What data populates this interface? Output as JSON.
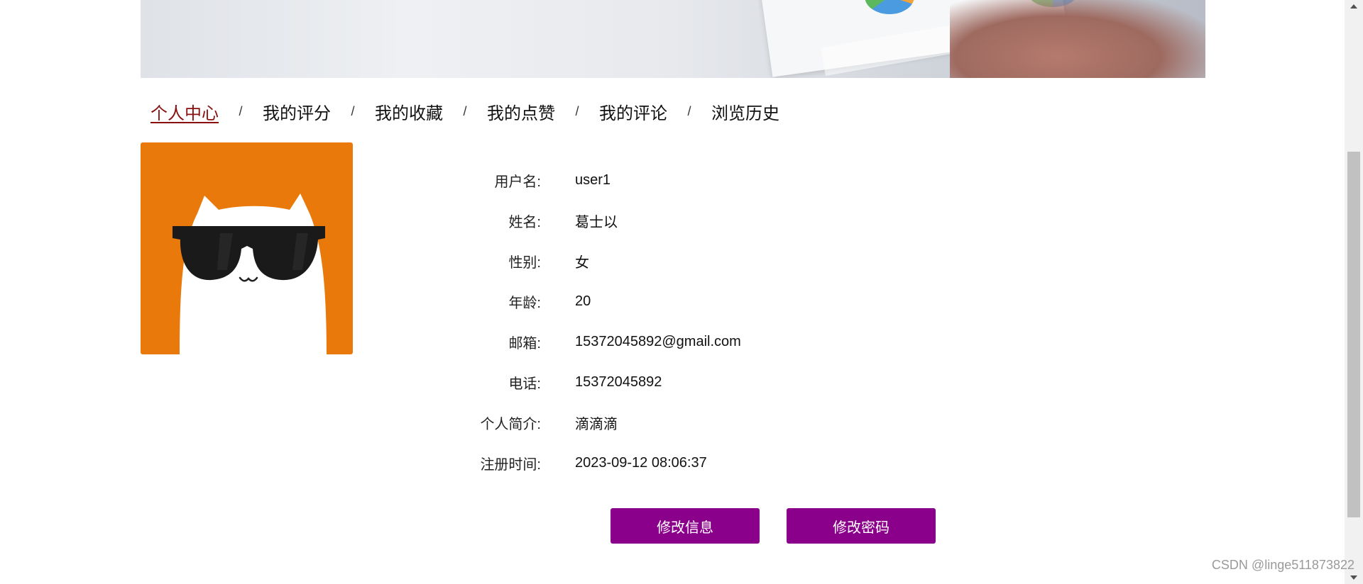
{
  "nav": {
    "items": [
      {
        "label": "个人中心",
        "active": true
      },
      {
        "label": "我的评分",
        "active": false
      },
      {
        "label": "我的收藏",
        "active": false
      },
      {
        "label": "我的点赞",
        "active": false
      },
      {
        "label": "我的评论",
        "active": false
      },
      {
        "label": "浏览历史",
        "active": false
      }
    ],
    "separator": "/"
  },
  "avatar": {
    "icon": "cat-with-sunglasses-icon",
    "background_color": "#e8790a"
  },
  "profile": {
    "fields": [
      {
        "label": "用户名:",
        "value": "user1"
      },
      {
        "label": "姓名:",
        "value": "葛士以"
      },
      {
        "label": "性别:",
        "value": "女"
      },
      {
        "label": "年龄:",
        "value": "20"
      },
      {
        "label": "邮箱:",
        "value": "15372045892@gmail.com"
      },
      {
        "label": "电话:",
        "value": "15372045892"
      },
      {
        "label": "个人简介:",
        "value": "滴滴滴"
      },
      {
        "label": "注册时间:",
        "value": "2023-09-12 08:06:37"
      }
    ]
  },
  "actions": {
    "edit_info_label": "修改信息",
    "change_password_label": "修改密码",
    "button_color": "#8b008b"
  },
  "watermark": "CSDN @linge511873822",
  "colors": {
    "active_nav": "#8a1010"
  }
}
